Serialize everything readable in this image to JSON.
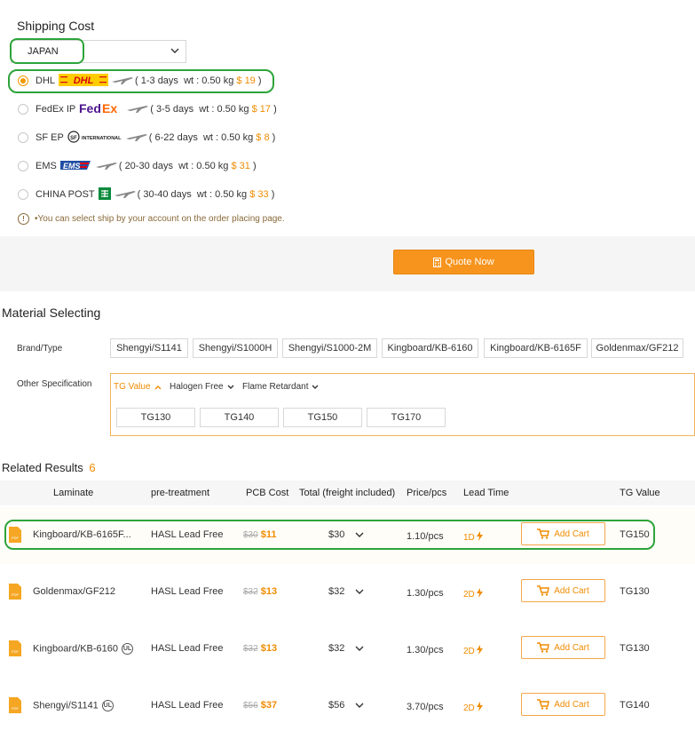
{
  "shipping": {
    "title": "Shipping Cost",
    "country": "JAPAN",
    "options": [
      {
        "carrier": "DHL",
        "logo": "dhl-logo",
        "days": "( 1-3 days",
        "weight": "wt : 0.50 kg",
        "price": "$ 19",
        "close": ")",
        "selected": true
      },
      {
        "carrier": "FedEx IP",
        "logo": "fedex-logo",
        "days": "( 3-5 days",
        "weight": "wt : 0.50 kg",
        "price": "$ 17",
        "close": ")",
        "selected": false
      },
      {
        "carrier": "SF EP",
        "logo": "sf-logo",
        "days": "( 6-22 days",
        "weight": "wt : 0.50 kg",
        "price": "$ 8",
        "close": ")",
        "selected": false
      },
      {
        "carrier": "EMS",
        "logo": "ems-logo",
        "days": "( 20-30 days",
        "weight": "wt : 0.50 kg",
        "price": "$ 31",
        "close": ")",
        "selected": false
      },
      {
        "carrier": "CHINA POST",
        "logo": "china-post-logo",
        "days": "( 30-40 days",
        "weight": "wt : 0.50 kg",
        "price": "$ 33",
        "close": ")",
        "selected": false
      }
    ],
    "note": "•You can select ship by your account on the order placing page."
  },
  "quote_button": "Quote Now",
  "material": {
    "title": "Material Selecting",
    "brand_label": "Brand/Type",
    "brands": [
      "Shengyi/S1141",
      "Shengyi/S1000H",
      "Shengyi/S1000-2M",
      "Kingboard/KB-6160",
      "Kingboard/KB-6165F",
      "Goldenmax/GF212"
    ],
    "spec_label": "Other Specification",
    "filters": [
      "TG Value",
      "Halogen Free",
      "Flame Retardant"
    ],
    "tg_options": [
      "TG130",
      "TG140",
      "TG150",
      "TG170"
    ]
  },
  "results": {
    "title": "Related Results",
    "count": "6",
    "columns": [
      "Laminate",
      "pre-treatment",
      "PCB Cost",
      "Total (freight included)",
      "Price/pcs",
      "Lead Time",
      "TG Value"
    ],
    "rows": [
      {
        "laminate": "Kingboard/KB-6165F...",
        "ul": false,
        "treatment": "HASL Lead Free",
        "old_cost": "$30",
        "cost": "$11",
        "total": "$30",
        "price": "1.10/pcs",
        "lead": "1D",
        "cart": "Add Cart",
        "tg": "TG150"
      },
      {
        "laminate": "Goldenmax/GF212",
        "ul": false,
        "treatment": "HASL Lead Free",
        "old_cost": "$32",
        "cost": "$13",
        "total": "$32",
        "price": "1.30/pcs",
        "lead": "2D",
        "cart": "Add Cart",
        "tg": "TG130"
      },
      {
        "laminate": "Kingboard/KB-6160",
        "ul": true,
        "treatment": "HASL Lead Free",
        "old_cost": "$32",
        "cost": "$13",
        "total": "$32",
        "price": "1.30/pcs",
        "lead": "2D",
        "cart": "Add Cart",
        "tg": "TG130"
      },
      {
        "laminate": "Shengyi/S1141",
        "ul": true,
        "treatment": "HASL Lead Free",
        "old_cost": "$56",
        "cost": "$37",
        "total": "$56",
        "price": "3.70/pcs",
        "lead": "2D",
        "cart": "Add Cart",
        "tg": "TG140"
      }
    ]
  },
  "ul_mark": "UL",
  "colors": {
    "accent": "#f7941d",
    "highlight": "#2ea43a"
  }
}
